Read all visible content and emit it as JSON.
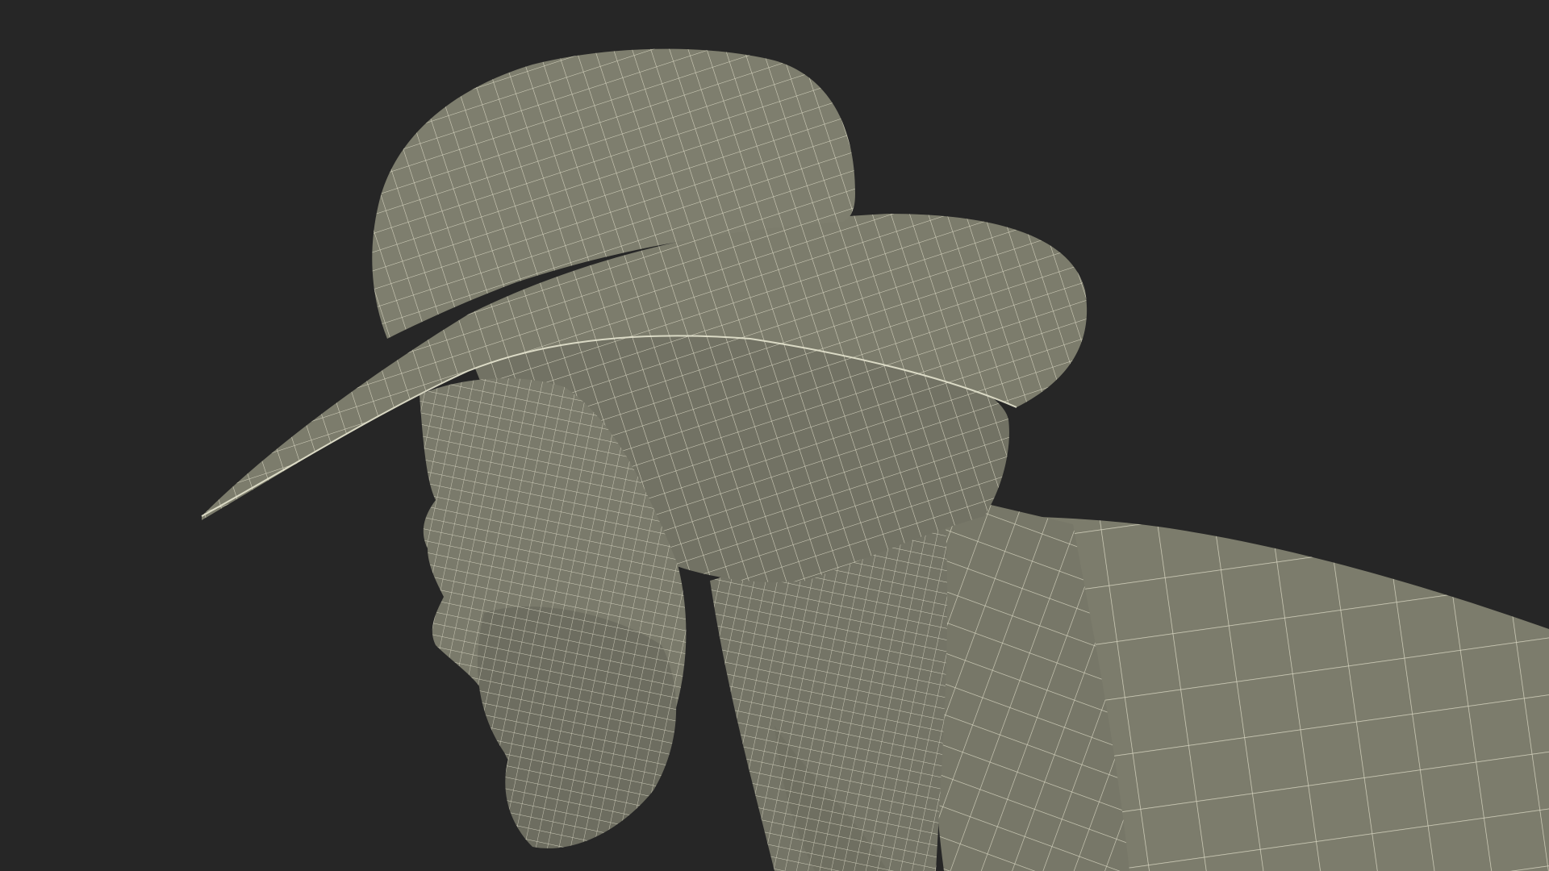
{
  "scene": {
    "background_color": "#262626",
    "mesh_fill_color": "#7c7c6c",
    "mesh_shadow_color": "#5e5e52",
    "wire_color": "#e6e4cf",
    "subject": "wireframe-figure-with-hat"
  }
}
